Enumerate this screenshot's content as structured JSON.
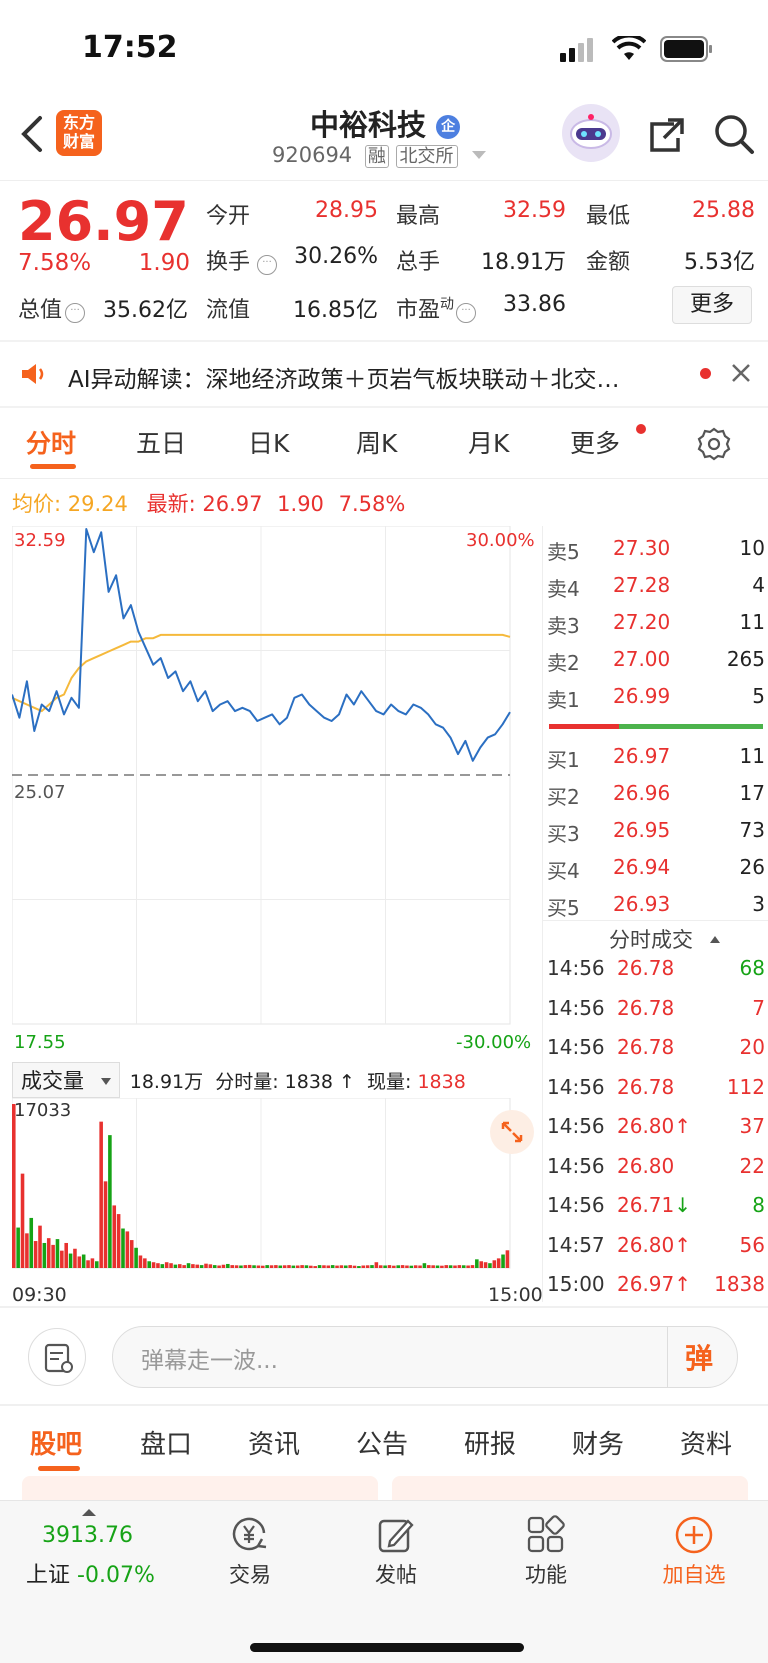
{
  "status": {
    "time": "17:52"
  },
  "header": {
    "logo": "东方\n财富",
    "logo_l1": "东方",
    "logo_l2": "财富",
    "title": "中裕科技",
    "badge": "企",
    "code": "920694",
    "margin_tag": "融",
    "exchange": "北交所"
  },
  "quote": {
    "price": "26.97",
    "pct": "7.58%",
    "change": "1.90",
    "open_label": "今开",
    "open": "28.95",
    "high_label": "最高",
    "high": "32.59",
    "low_label": "最低",
    "low": "25.88",
    "turnover_label": "换手",
    "turnover": "30.26%",
    "volume_label": "总手",
    "volume": "18.91万",
    "amount_label": "金额",
    "amount": "5.53亿",
    "mcap_label": "总值",
    "mcap": "35.62亿",
    "float_label": "流值",
    "float": "16.85亿",
    "pe_label": "市盈",
    "pe_sup": "动",
    "pe": "33.86",
    "more_label": "更多"
  },
  "ai_bar": {
    "text": "AI异动解读：深地经济政策＋页岩气板块联动＋北交…"
  },
  "chart_tabs": [
    "分时",
    "五日",
    "日K",
    "周K",
    "月K",
    "更多"
  ],
  "chart_info": {
    "avg_label": "均价:",
    "avg": "29.24",
    "last_label": "最新:",
    "last": "26.97",
    "chg": "1.90",
    "pct": "7.58%"
  },
  "chart_labels": {
    "y_top": "32.59",
    "y_mid": "25.07",
    "y_bot": "17.55",
    "pct_top": "30.00%",
    "pct_bot": "-30.00%",
    "vol_selector": "成交量",
    "vol_total": "18.91万",
    "vol_min_label": "分时量:",
    "vol_min": "1838 ↑",
    "vol_now_label": "现量:",
    "vol_now": "1838",
    "vol_max": "17033",
    "t_start": "09:30",
    "t_end": "15:00"
  },
  "chart_data": {
    "type": "line",
    "title": "",
    "x_range": [
      "09:30",
      "15:00"
    ],
    "ylim": [
      17.55,
      32.59
    ],
    "pre_close": 25.07,
    "series": [
      {
        "name": "",
        "role": "price",
        "color": "#2b6fc2",
        "values": [
          27.5,
          26.8,
          27.9,
          26.4,
          27.2,
          27.0,
          27.6,
          26.9,
          27.4,
          27.1,
          32.5,
          31.8,
          32.4,
          30.6,
          31.1,
          29.8,
          30.2,
          29.4,
          28.9,
          28.4,
          28.6,
          28.0,
          28.2,
          27.6,
          27.9,
          27.3,
          27.6,
          27.0,
          27.2,
          27.3,
          27.0,
          27.1,
          27.0,
          26.7,
          26.8,
          26.9,
          26.6,
          26.8,
          27.4,
          27.5,
          27.2,
          27.0,
          26.8,
          26.7,
          26.9,
          27.5,
          27.2,
          27.6,
          27.3,
          27.0,
          26.9,
          27.2,
          27.0,
          26.9,
          27.2,
          27.1,
          26.9,
          26.6,
          26.5,
          26.2,
          25.7,
          26.1,
          25.5,
          25.9,
          26.2,
          26.3,
          26.6,
          26.97
        ]
      },
      {
        "name": "",
        "role": "average",
        "color": "#f5b93b",
        "values": [
          27.4,
          27.3,
          27.2,
          27.1,
          27.0,
          27.2,
          27.4,
          27.5,
          28.0,
          28.3,
          28.5,
          28.6,
          28.7,
          28.8,
          28.9,
          29.0,
          29.1,
          29.1,
          29.2,
          29.2,
          29.3,
          29.3,
          29.3,
          29.3,
          29.3,
          29.3,
          29.3,
          29.3,
          29.3,
          29.3,
          29.3,
          29.3,
          29.3,
          29.3,
          29.3,
          29.3,
          29.3,
          29.3,
          29.3,
          29.3,
          29.3,
          29.3,
          29.3,
          29.3,
          29.3,
          29.3,
          29.3,
          29.3,
          29.3,
          29.3,
          29.3,
          29.3,
          29.3,
          29.3,
          29.3,
          29.3,
          29.3,
          29.3,
          29.3,
          29.3,
          29.3,
          29.3,
          29.3,
          29.3,
          29.3,
          29.3,
          29.3,
          29.24
        ]
      }
    ],
    "volume": {
      "max": 17033,
      "values": [
        17033,
        4200,
        9800,
        3600,
        5200,
        2800,
        4400,
        2600,
        3100,
        2400,
        3000,
        1800,
        2600,
        1500,
        2000,
        1200,
        1400,
        800,
        1000,
        700,
        15200,
        9000,
        13800,
        6500,
        5600,
        4100,
        3800,
        2900,
        2100,
        1300,
        1000,
        700,
        600,
        500,
        400,
        600,
        500,
        350,
        400,
        300,
        500,
        400,
        350,
        300,
        450,
        380,
        300,
        260,
        340,
        420,
        300,
        280,
        260,
        300,
        320,
        280,
        260,
        240,
        300,
        280,
        300,
        260,
        280,
        300,
        250,
        260,
        300,
        280,
        240,
        200,
        300,
        280,
        260,
        300,
        250,
        280,
        260,
        300,
        240,
        200,
        260,
        280,
        300,
        600,
        280,
        260,
        300,
        240,
        280,
        300,
        260,
        240,
        280,
        260,
        500,
        300,
        280,
        260,
        240,
        300,
        280,
        260,
        300,
        280,
        260,
        300,
        900,
        700,
        600,
        500,
        800,
        1000,
        1400,
        1838
      ]
    }
  },
  "orderbook": {
    "asks": [
      {
        "label": "卖5",
        "price": "27.30",
        "qty": "10"
      },
      {
        "label": "卖4",
        "price": "27.28",
        "qty": "4"
      },
      {
        "label": "卖3",
        "price": "27.20",
        "qty": "11"
      },
      {
        "label": "卖2",
        "price": "27.00",
        "qty": "265"
      },
      {
        "label": "卖1",
        "price": "26.99",
        "qty": "5"
      }
    ],
    "bids": [
      {
        "label": "买1",
        "price": "26.97",
        "qty": "11"
      },
      {
        "label": "买2",
        "price": "26.96",
        "qty": "17"
      },
      {
        "label": "买3",
        "price": "26.95",
        "qty": "73"
      },
      {
        "label": "买4",
        "price": "26.94",
        "qty": "26"
      },
      {
        "label": "买5",
        "price": "26.93",
        "qty": "3"
      }
    ],
    "ticks_title": "分时成交"
  },
  "ticks": [
    {
      "time": "14:56",
      "price": "26.78",
      "qty": "68",
      "qty_color": "green",
      "dir": ""
    },
    {
      "time": "14:56",
      "price": "26.78",
      "qty": "7",
      "qty_color": "red",
      "dir": ""
    },
    {
      "time": "14:56",
      "price": "26.78",
      "qty": "20",
      "qty_color": "red",
      "dir": ""
    },
    {
      "time": "14:56",
      "price": "26.78",
      "qty": "112",
      "qty_color": "red",
      "dir": ""
    },
    {
      "time": "14:56",
      "price": "26.80",
      "qty": "37",
      "qty_color": "red",
      "dir": "↑"
    },
    {
      "time": "14:56",
      "price": "26.80",
      "qty": "22",
      "qty_color": "red",
      "dir": ""
    },
    {
      "time": "14:56",
      "price": "26.71",
      "qty": "8",
      "qty_color": "green",
      "dir": "↓"
    },
    {
      "time": "14:57",
      "price": "26.80",
      "qty": "56",
      "qty_color": "red",
      "dir": "↑"
    },
    {
      "time": "15:00",
      "price": "26.97",
      "qty": "1838",
      "qty_color": "red",
      "dir": "↑"
    }
  ],
  "comment": {
    "placeholder": "弹幕走一波...",
    "danmu": "弹"
  },
  "bottom_tabs": [
    "股吧",
    "盘口",
    "资讯",
    "公告",
    "研报",
    "财务",
    "资料"
  ],
  "dock": {
    "index_value": "3913.76",
    "index_name": "上证",
    "index_change": "-0.07%",
    "trade": "交易",
    "post": "发帖",
    "func": "功能",
    "watch": "加自选"
  },
  "colors": {
    "up": "#e8312f",
    "down": "#16a316",
    "accent": "#f5621d",
    "price_line": "#2b6fc2",
    "avg_line": "#f5b93b"
  }
}
